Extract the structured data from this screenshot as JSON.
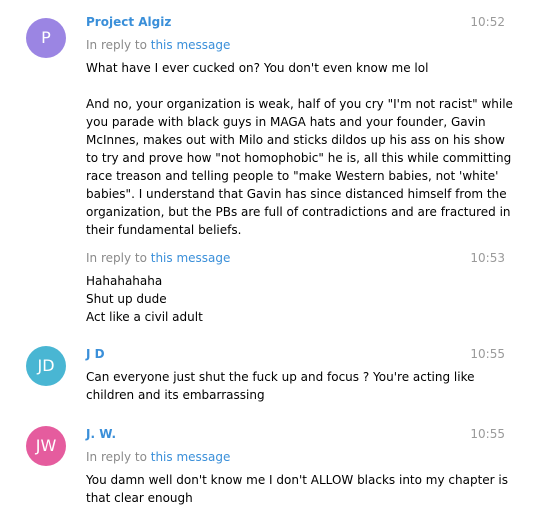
{
  "messages": [
    {
      "avatar_initials": "P",
      "avatar_color": "#9b85e3",
      "sender": "Project Algiz",
      "time": "10:52",
      "reply_prefix": "In reply to ",
      "reply_link": "this message",
      "text_lines": [
        "What have I ever cucked on? You don't even know me lol",
        "",
        "And no, your organization is weak, half of you cry \"I'm not racist\" while",
        "you parade with black guys in MAGA hats and your founder, Gavin",
        "McInnes, makes out with Milo and sticks dildos up his ass on his show",
        "to try and prove how \"not homophobic\" he is, all this while committing",
        "race treason and telling people to \"make Western babies, not 'white'",
        "babies\". I understand that Gavin has since distanced himself from the",
        "organization, but the PBs are full of contradictions and are fractured in",
        "their fundamental beliefs."
      ]
    },
    {
      "time": "10:53",
      "reply_prefix": "In reply to ",
      "reply_link": "this message",
      "text_lines": [
        "Hahahahaha",
        "Shut up dude",
        "Act like a civil adult"
      ]
    },
    {
      "avatar_initials": "JD",
      "avatar_color": "#49b6d3",
      "sender": "J D",
      "time": "10:55",
      "text_lines": [
        "Can everyone just shut the fuck up and focus ? You're acting like",
        "children and its embarrassing"
      ]
    },
    {
      "avatar_initials": "JW",
      "avatar_color": "#e55c9e",
      "sender": "J. W.",
      "time": "10:55",
      "reply_prefix": "In reply to ",
      "reply_link": "this message",
      "text_lines": [
        "You damn well don't know me I don't ALLOW blacks into my chapter is",
        "that clear enough"
      ]
    }
  ]
}
